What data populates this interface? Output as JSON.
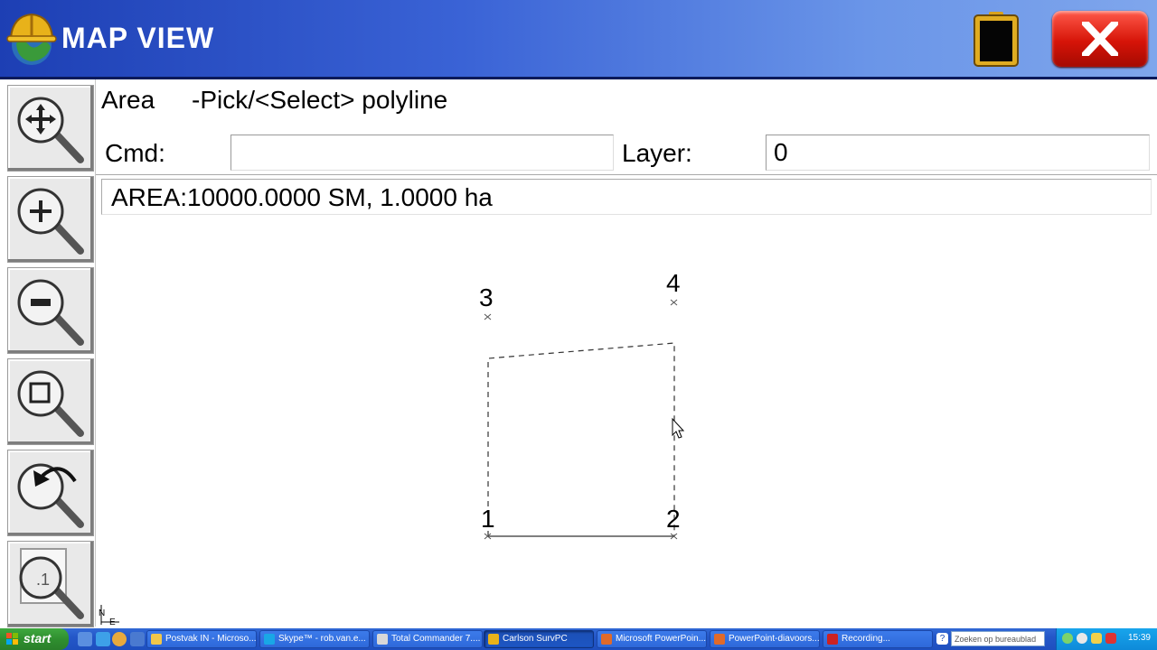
{
  "app": {
    "title": "MAP VIEW"
  },
  "prompt": {
    "command_name": "Area",
    "text": "-Pick/<Select> polyline"
  },
  "cmd": {
    "label": "Cmd:",
    "value": ""
  },
  "layer": {
    "label": "Layer:",
    "value": "0"
  },
  "result": {
    "text": "AREA:10000.0000 SM, 1.0000 ha"
  },
  "toolbar": {
    "tools": [
      "pan",
      "zoom-in",
      "zoom-out",
      "zoom-window",
      "zoom-previous",
      "zoom-extents"
    ]
  },
  "map": {
    "points": [
      {
        "label": "1"
      },
      {
        "label": "2"
      },
      {
        "label": "3"
      },
      {
        "label": "4"
      }
    ],
    "north_label": "N",
    "east_label": "E"
  },
  "taskbar": {
    "start_label": "start",
    "tasks": [
      {
        "label": "Postvak IN - Microso..."
      },
      {
        "label": "Skype™ - rob.van.e..."
      },
      {
        "label": "Total Commander 7...."
      },
      {
        "label": "Carlson SurvPC"
      },
      {
        "label": "Microsoft PowerPoin..."
      },
      {
        "label": "PowerPoint-diavoors..."
      },
      {
        "label": "Recording..."
      }
    ],
    "search_placeholder": "Zoeken op bureaublad",
    "clock": "15:39"
  },
  "colors": {
    "title_gradient_start": "#1d3fb4",
    "title_gradient_end": "#7fa6ec",
    "close_red": "#d61408",
    "taskbar_blue": "#2457c8",
    "start_green": "#2f8f2f"
  }
}
